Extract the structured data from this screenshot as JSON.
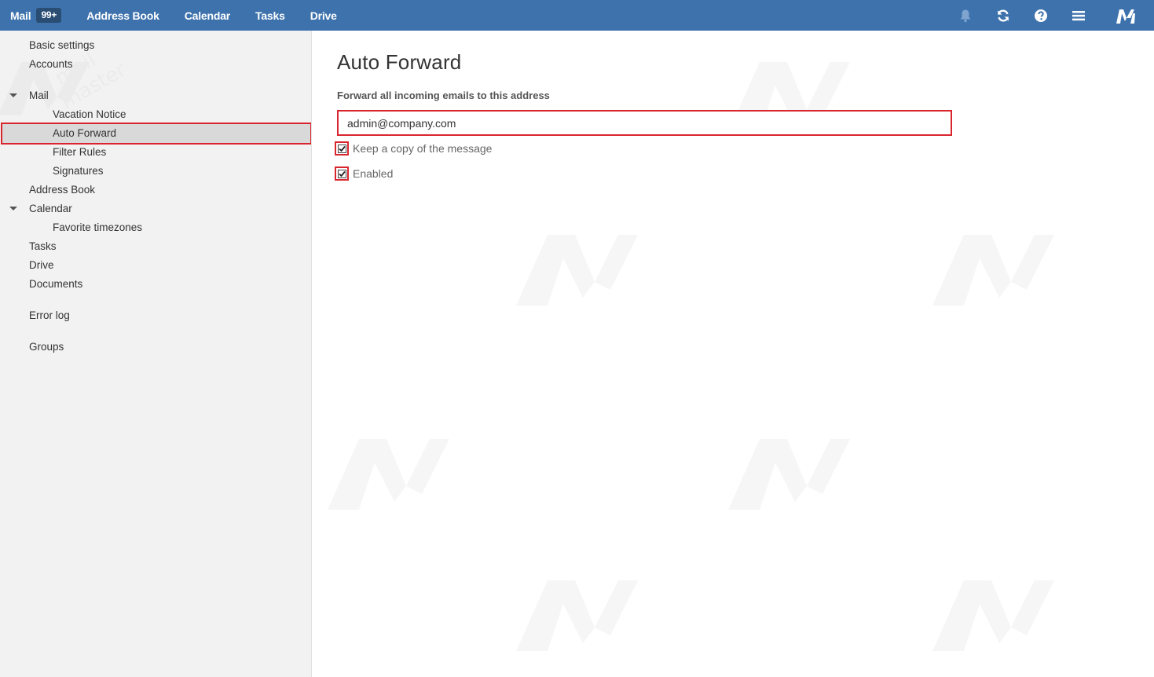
{
  "topbar": {
    "nav": [
      {
        "label": "Mail",
        "badge": "99+"
      },
      {
        "label": "Address Book"
      },
      {
        "label": "Calendar"
      },
      {
        "label": "Tasks"
      },
      {
        "label": "Drive"
      }
    ],
    "icons": [
      "bell-icon",
      "refresh-icon",
      "help-icon",
      "menu-icon",
      "app-logo"
    ]
  },
  "sidebar": {
    "items": [
      {
        "label": "Basic settings"
      },
      {
        "label": "Accounts"
      },
      {
        "label": "Mail"
      },
      {
        "label": "Vacation Notice"
      },
      {
        "label": "Auto Forward"
      },
      {
        "label": "Filter Rules"
      },
      {
        "label": "Signatures"
      },
      {
        "label": "Address Book"
      },
      {
        "label": "Calendar"
      },
      {
        "label": "Favorite timezones"
      },
      {
        "label": "Tasks"
      },
      {
        "label": "Drive"
      },
      {
        "label": "Documents"
      },
      {
        "label": "Error log"
      },
      {
        "label": "Groups"
      }
    ],
    "selected": "Auto Forward"
  },
  "main": {
    "title": "Auto Forward",
    "field_label": "Forward all incoming emails to this address",
    "forward_address": "admin@company.com",
    "keep_copy_label": "Keep a copy of the message",
    "keep_copy_checked": true,
    "enabled_label": "Enabled",
    "enabled_checked": true
  },
  "watermark": {
    "line1": "mail",
    "line2": "master"
  },
  "colors": {
    "topbar": "#3d72ad",
    "highlight": "#d9262e",
    "sidebar_bg": "#f2f2f2"
  }
}
